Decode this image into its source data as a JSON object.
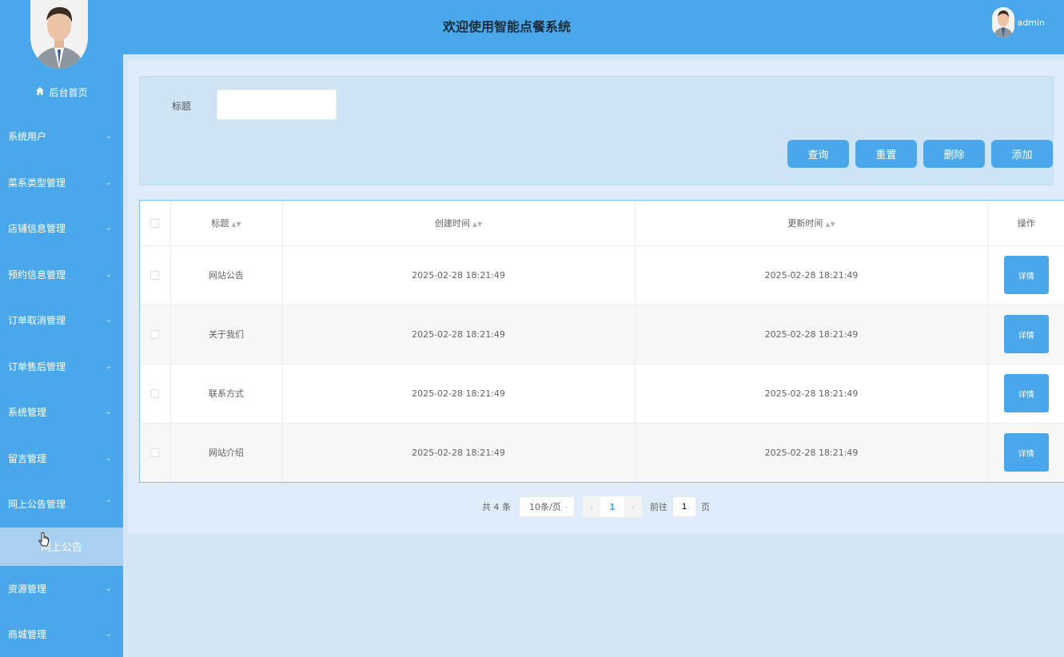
{
  "header": {
    "title": "欢迎使用智能点餐系统",
    "username": "admin"
  },
  "sidebar": {
    "home_label": "后台首页",
    "items": [
      {
        "label": "系统用户"
      },
      {
        "label": "菜系类型管理"
      },
      {
        "label": "店铺信息管理"
      },
      {
        "label": "预约信息管理"
      },
      {
        "label": "订单取消管理"
      },
      {
        "label": "订单售后管理"
      },
      {
        "label": "系统管理"
      },
      {
        "label": "留言管理"
      },
      {
        "label": "网上公告管理"
      }
    ],
    "submenu_label": "网上公告",
    "items_after": [
      {
        "label": "资源管理"
      },
      {
        "label": "商城管理"
      }
    ]
  },
  "search": {
    "label": "标题",
    "value": ""
  },
  "buttons": {
    "query": "查询",
    "reset": "重置",
    "delete": "删除",
    "add": "添加"
  },
  "table": {
    "headers": [
      "标题",
      "创建时间",
      "更新时间",
      "操作"
    ],
    "rows": [
      {
        "title": "网站公告",
        "created": "2025-02-28 18:21:49",
        "updated": "2025-02-28 18:21:49",
        "action": "详情"
      },
      {
        "title": "关于我们",
        "created": "2025-02-28 18:21:49",
        "updated": "2025-02-28 18:21:49",
        "action": "详情"
      },
      {
        "title": "联系方式",
        "created": "2025-02-28 18:21:49",
        "updated": "2025-02-28 18:21:49",
        "action": "详情"
      },
      {
        "title": "网站介绍",
        "created": "2025-02-28 18:21:49",
        "updated": "2025-02-28 18:21:49",
        "action": "详情"
      }
    ]
  },
  "pagination": {
    "total": "共 4 条",
    "page_size": "10条/页",
    "current_page": "1",
    "goto_prefix": "前往",
    "goto_value": "1",
    "goto_suffix": "页"
  },
  "colors": {
    "primary": "#4aa8ea",
    "submenu_active": "#a9cff1"
  }
}
